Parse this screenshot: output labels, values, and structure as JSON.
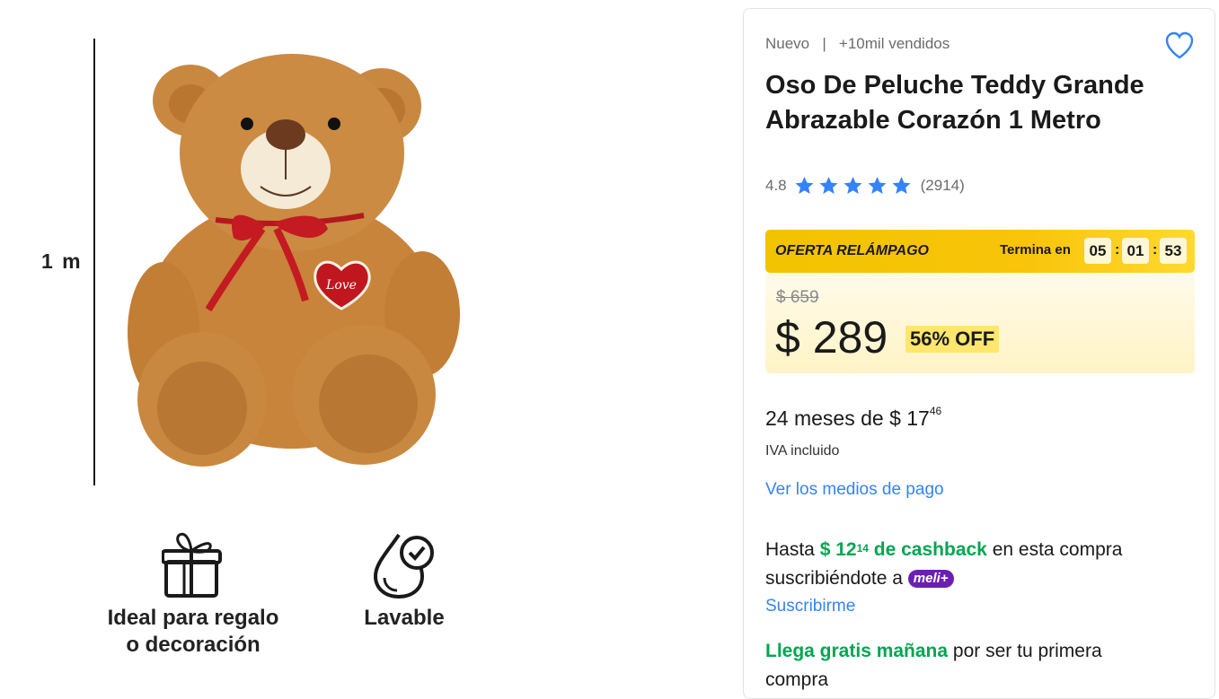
{
  "gallery": {
    "measure_label": "1 m",
    "features": [
      {
        "icon": "gift-icon",
        "label_line1": "Ideal para regalo",
        "label_line2": "o decoración"
      },
      {
        "icon": "water-drop-check-icon",
        "label_line1": "Lavable"
      }
    ],
    "bear_heart_text": "Love"
  },
  "product": {
    "condition": "Nuevo",
    "sold": "+10mil vendidos",
    "title": "Oso De Peluche Teddy Grande Abrazable Corazón 1 Metro",
    "rating": "4.8",
    "rating_stars": 5,
    "reviews": "(2914)"
  },
  "flash_sale": {
    "label": "OFERTA RELÁMPAGO",
    "ends_label": "Termina en",
    "hours": "05",
    "minutes": "01",
    "seconds": "53"
  },
  "price": {
    "old": "$ 659",
    "current": "$ 289",
    "discount": "56% OFF"
  },
  "installments": {
    "text": "24 meses de $ 17",
    "cents": "46",
    "tax_note": "IVA incluido",
    "payment_link": "Ver los medios de pago"
  },
  "cashback": {
    "prefix": "Hasta",
    "amount": "$ 12",
    "cents": "14",
    "amount_suffix": "de cashback",
    "middle": "en esta compra suscribiéndote a",
    "brand": "meli+",
    "subscribe_link": "Suscribirme"
  },
  "shipping": {
    "highlight": "Llega gratis mañana",
    "rest": "por ser tu primera compra"
  },
  "colors": {
    "accent_blue": "#3483fa",
    "green": "#00a650",
    "flash_yellow": "#f9c40a",
    "meli_purple": "#6b1fb2"
  }
}
